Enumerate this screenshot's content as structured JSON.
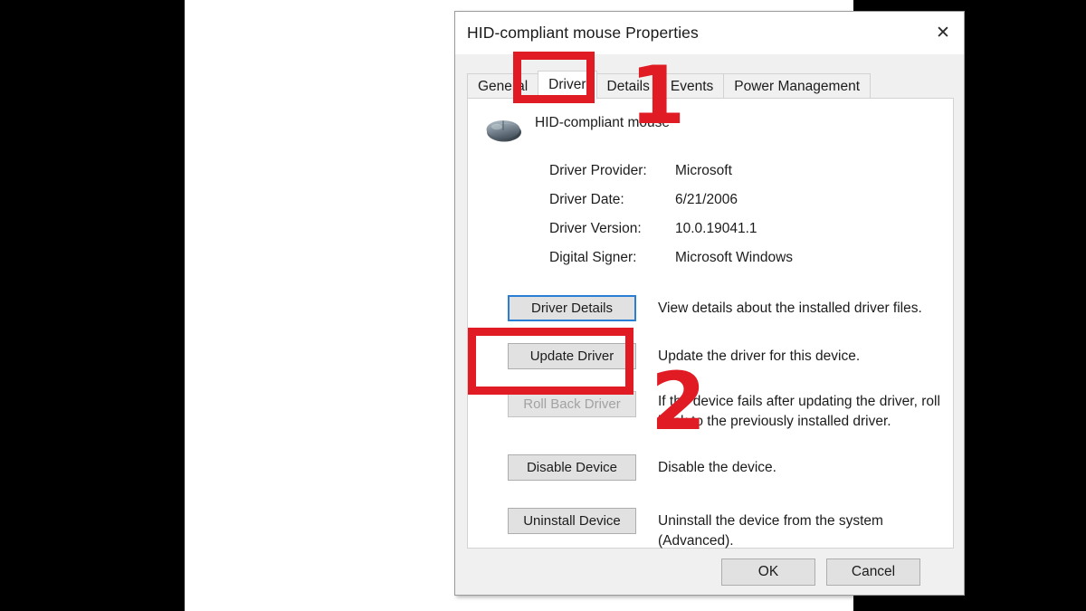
{
  "window": {
    "title": "HID-compliant mouse Properties",
    "close_icon": "close-icon",
    "close_glyph": "✕"
  },
  "tabs": [
    {
      "label": "General",
      "active": false
    },
    {
      "label": "Driver",
      "active": true
    },
    {
      "label": "Details",
      "active": false
    },
    {
      "label": "Events",
      "active": false
    },
    {
      "label": "Power Management",
      "active": false
    }
  ],
  "device": {
    "icon": "mouse-icon",
    "name": "HID-compliant mouse"
  },
  "driver_info": [
    {
      "label": "Driver Provider:",
      "value": "Microsoft"
    },
    {
      "label": "Driver Date:",
      "value": "6/21/2006"
    },
    {
      "label": "Driver Version:",
      "value": "10.0.19041.1"
    },
    {
      "label": "Digital Signer:",
      "value": "Microsoft Windows"
    }
  ],
  "actions": [
    {
      "button": "Driver Details",
      "description": "View details about the installed driver files.",
      "state": "focused"
    },
    {
      "button": "Update Driver",
      "description": "Update the driver for this device.",
      "state": "normal"
    },
    {
      "button": "Roll Back Driver",
      "description": "If the device fails after updating the driver, roll back to the previously installed driver.",
      "state": "disabled"
    },
    {
      "button": "Disable Device",
      "description": "Disable the device.",
      "state": "normal"
    },
    {
      "button": "Uninstall Device",
      "description": "Uninstall the device from the system (Advanced).",
      "state": "normal"
    }
  ],
  "footer": {
    "ok": "OK",
    "cancel": "Cancel"
  },
  "annotations": {
    "step_one": "1",
    "step_two": "2",
    "highlight_color": "#e01b24"
  }
}
